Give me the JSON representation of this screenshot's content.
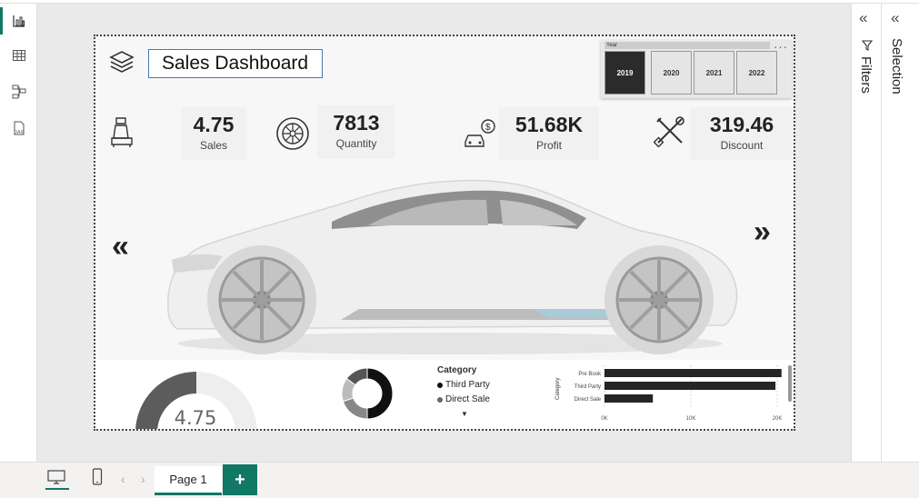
{
  "left_rail": {
    "icons": [
      "report-view-icon",
      "table-view-icon",
      "model-view-icon",
      "dax-query-icon"
    ]
  },
  "dashboard": {
    "title": "Sales Dashboard",
    "slicer": {
      "header": "Year",
      "more": "···",
      "options": [
        "2019",
        "2020",
        "2021",
        "2022"
      ],
      "selected": "2019"
    },
    "kpis": [
      {
        "value": "4.75",
        "label": "Sales",
        "icon": "car-seat-icon"
      },
      {
        "value": "7813",
        "label": "Quantity",
        "icon": "wheel-icon"
      },
      {
        "value": "51.68K",
        "label": "Profit",
        "icon": "car-money-icon"
      },
      {
        "value": "319.46",
        "label": "Discount",
        "icon": "tools-icon"
      }
    ],
    "nav": {
      "prev": "«",
      "next": "»"
    },
    "gauge": {
      "value": "4.75",
      "fill_fraction": 0.5
    },
    "donut": {
      "segments": [
        0.5,
        0.2,
        0.15,
        0.15
      ]
    },
    "legend": {
      "title": "Category",
      "items": [
        {
          "label": "Third Party",
          "color": "#111111"
        },
        {
          "label": "Direct Sale",
          "color": "#666666"
        }
      ]
    }
  },
  "chart_data": {
    "type": "bar",
    "orientation": "horizontal",
    "categories": [
      "Pre Book",
      "Third Party",
      "Direct Sale"
    ],
    "values": [
      20500,
      19800,
      5600
    ],
    "ylabel": "Category",
    "xticks": [
      "0K",
      "10K",
      "20K"
    ],
    "xlim": [
      0,
      20000
    ],
    "bar_color": "#252525"
  },
  "right_panes": {
    "filters_label": "Filters",
    "selection_label": "Selection",
    "collapse_glyph": "«"
  },
  "bottom_bar": {
    "page_tab": "Page 1",
    "add_label": "+",
    "prev": "‹",
    "next": "›"
  },
  "colors": {
    "accent": "#117865"
  }
}
